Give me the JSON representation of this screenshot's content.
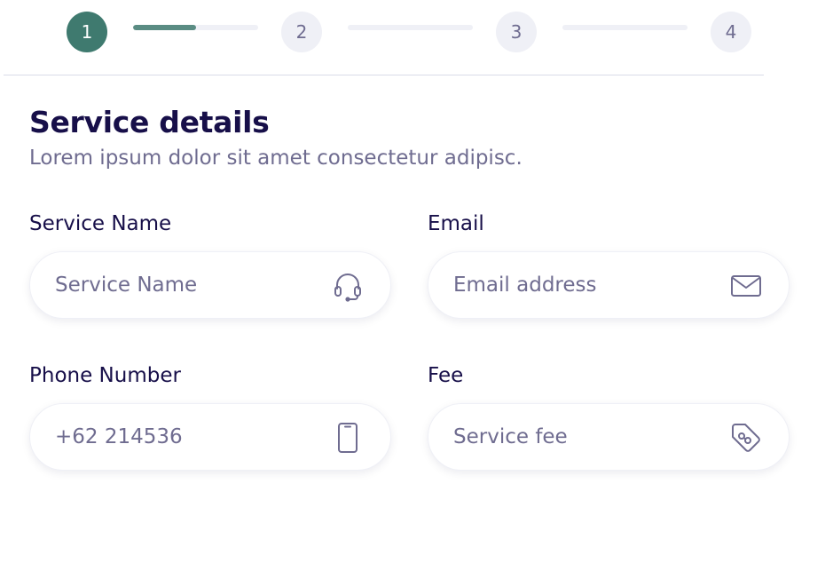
{
  "stepper": {
    "steps": [
      "1",
      "2",
      "3",
      "4"
    ],
    "active_step": 1,
    "progress": [
      0.5,
      0,
      0
    ],
    "colors": {
      "active": "#3f7a6f",
      "inactive": "#eff0f6",
      "inactive_text": "#6f6c90"
    }
  },
  "header": {
    "title": "Service details",
    "subtitle": "Lorem ipsum dolor sit amet consectetur adipisc."
  },
  "form": {
    "service_name": {
      "label": "Service Name",
      "placeholder": "Service Name",
      "value": "",
      "icon": "headset-icon"
    },
    "email": {
      "label": "Email",
      "placeholder": "Email address",
      "value": "",
      "icon": "mail-icon"
    },
    "phone": {
      "label": "Phone Number",
      "placeholder": "+62 214536",
      "value": "",
      "icon": "phone-icon"
    },
    "fee": {
      "label": "Fee",
      "placeholder": "Service fee",
      "value": "",
      "icon": "price-tag-icon"
    }
  },
  "colors": {
    "heading": "#170f49",
    "muted": "#6f6c90",
    "border": "#eff0f6"
  }
}
